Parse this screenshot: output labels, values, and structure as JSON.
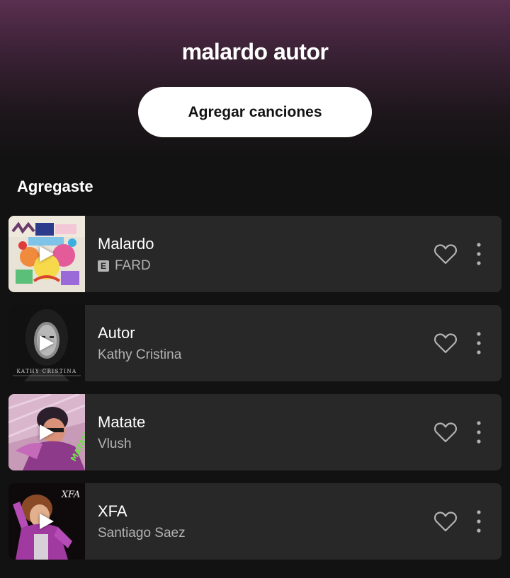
{
  "playlist": {
    "title": "malardo autor",
    "add_button_label": "Agregar canciones"
  },
  "section": {
    "label": "Agregaste"
  },
  "tracks": [
    {
      "title": "Malardo",
      "artist": "FARD",
      "explicit": true,
      "explicit_badge": "E"
    },
    {
      "title": "Autor",
      "artist": "Kathy Cristina",
      "explicit": false,
      "cover_text": "KATHY CRISTINA"
    },
    {
      "title": "Matate",
      "artist": "Vlush",
      "explicit": false,
      "cover_text": "MATATE"
    },
    {
      "title": "XFA",
      "artist": "Santiago Saez",
      "explicit": false,
      "cover_text": "XFA"
    }
  ],
  "icons": {
    "like": "heart-outline-icon",
    "more": "vertical-dots-icon",
    "play": "play-icon"
  },
  "colors": {
    "header_top": "#5a3050",
    "background": "#121212",
    "card": "#282828",
    "secondary_text": "#b3b3b3"
  }
}
